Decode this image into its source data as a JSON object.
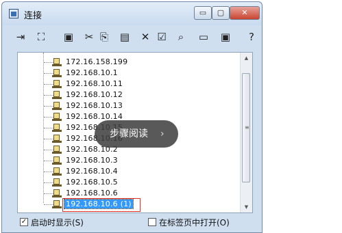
{
  "window": {
    "title": "连接"
  },
  "controls": {
    "minimize": "▭",
    "maximize": "▢",
    "close": "✕"
  },
  "toolbar": [
    {
      "name": "connect-icon",
      "glyph": "⇥"
    },
    {
      "name": "disconnect-icon",
      "glyph": "⛶"
    },
    {
      "name": "new-folder-icon",
      "glyph": "▣"
    },
    {
      "name": "cut-icon",
      "glyph": "✂"
    },
    {
      "name": "copy-icon",
      "glyph": "⎘"
    },
    {
      "name": "paste-icon",
      "glyph": "▤"
    },
    {
      "name": "delete-icon",
      "glyph": "✕"
    },
    {
      "name": "properties-icon",
      "glyph": "☑"
    },
    {
      "name": "find-icon",
      "glyph": "⌕"
    },
    {
      "name": "folder-icon",
      "glyph": "▭"
    },
    {
      "name": "terminal-icon",
      "glyph": "▣"
    },
    {
      "name": "help-icon",
      "glyph": "?"
    }
  ],
  "sessions": [
    "172.16.158.199",
    "192.168.10.1",
    "192.168.10.11",
    "192.168.10.12",
    "192.168.10.13",
    "192.168.10.14",
    "192.168.10.15",
    "192.168.10.16",
    "192.168.10.2",
    "192.168.10.3",
    "192.168.10.4",
    "192.168.10.5",
    "192.168.10.6",
    "192.168.10.6 (1)"
  ],
  "selected_index": 13,
  "overlay": {
    "text": "步骤阅读",
    "arrow": "›"
  },
  "footer": {
    "show_on_startup": {
      "label": "启动时显示(S)",
      "checked": true
    },
    "open_in_tab": {
      "label": "在标签页中打开(O)",
      "checked": false
    }
  }
}
